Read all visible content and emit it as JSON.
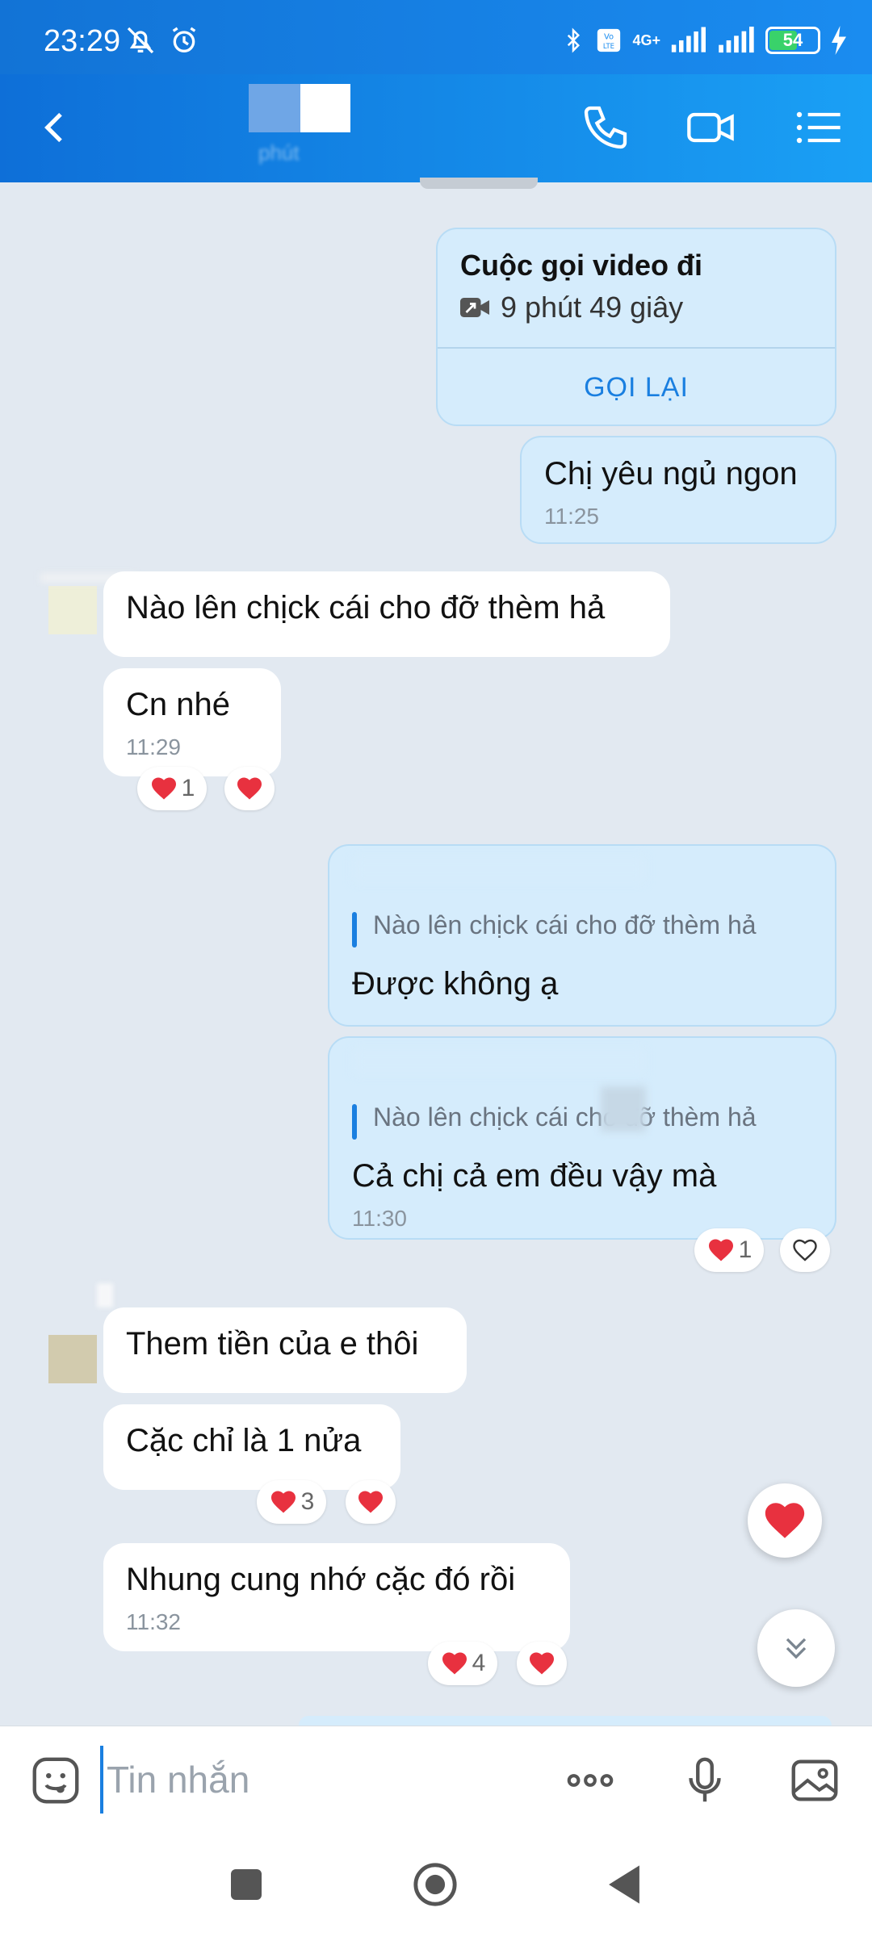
{
  "status_bar": {
    "time": "23:29",
    "network": "4G+",
    "battery": "54",
    "icons": [
      "bell-off-icon",
      "alarm-icon",
      "bluetooth-icon",
      "volte-icon",
      "signal-icon",
      "battery-icon",
      "charging-icon"
    ]
  },
  "header": {
    "contact_name": "",
    "status": "phút",
    "icons": [
      "back-arrow-icon",
      "phone-icon",
      "video-camera-icon",
      "menu-list-icon"
    ]
  },
  "messages": {
    "call": {
      "title": "Cuộc gọi video đi",
      "duration": "9 phút 49 giây",
      "action": "GỌI LẠI"
    },
    "m1": {
      "text": "Chị yêu ngủ ngon",
      "time": "11:25"
    },
    "m2": {
      "text": "Nào lên chịck cái cho đỡ thèm hả"
    },
    "m3": {
      "text": "Cn nhé",
      "time": "11:29",
      "reaction_count": "1"
    },
    "m4": {
      "quote": "Nào lên chịck cái cho đỡ thèm hả",
      "text": "Được không ạ"
    },
    "m5": {
      "quote": "Nào lên chịck cái cho đỡ thèm hả",
      "text": "Cả chị cả em đều vậy mà",
      "time": "11:30",
      "reaction_count": "1"
    },
    "m6": {
      "text": "Them tiền của e thôi"
    },
    "m7": {
      "text": "Cặc chỉ là 1 nửa",
      "reaction_count": "3"
    },
    "m8": {
      "text": "Nhung cung nhớ cặc đó rồi",
      "time": "11:32",
      "reaction_count": "4"
    }
  },
  "input": {
    "placeholder": "Tin nhắn",
    "icons": [
      "sticker-icon",
      "more-dots-icon",
      "microphone-icon",
      "image-icon"
    ]
  },
  "colors": {
    "header": "#1a8cf0",
    "sent_bubble": "#d5ecfc",
    "received_bubble": "#ffffff",
    "accent": "#1a7fe0",
    "heart": "#e8313f"
  }
}
